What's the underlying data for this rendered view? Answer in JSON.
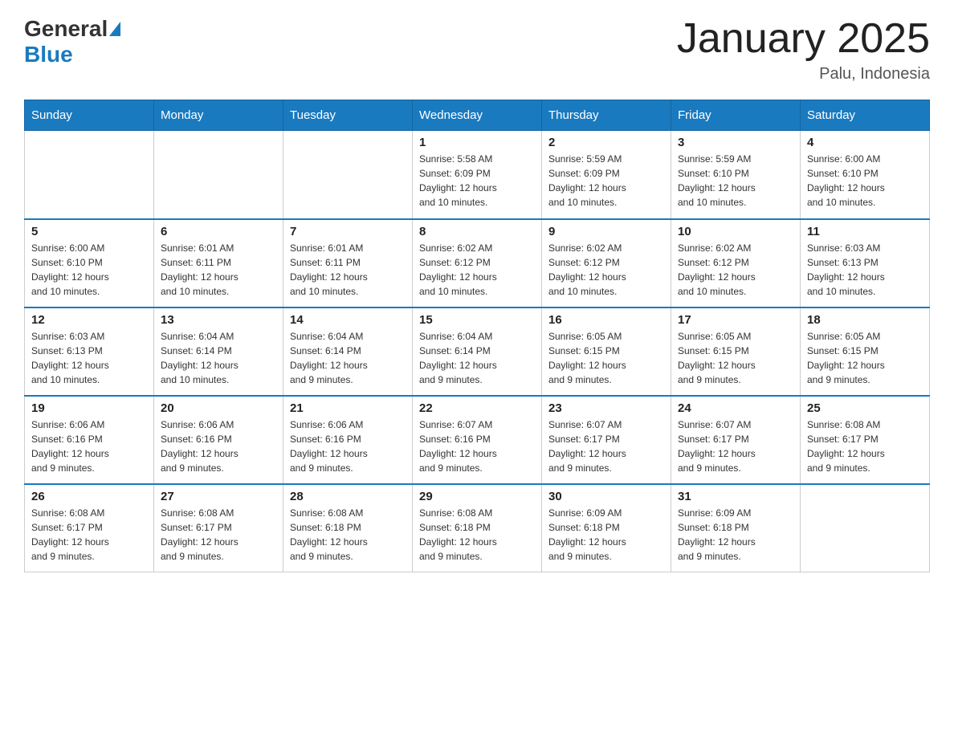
{
  "header": {
    "logo_general": "General",
    "logo_blue": "Blue",
    "title": "January 2025",
    "subtitle": "Palu, Indonesia"
  },
  "days_of_week": [
    "Sunday",
    "Monday",
    "Tuesday",
    "Wednesday",
    "Thursday",
    "Friday",
    "Saturday"
  ],
  "weeks": [
    [
      {
        "num": "",
        "info": ""
      },
      {
        "num": "",
        "info": ""
      },
      {
        "num": "",
        "info": ""
      },
      {
        "num": "1",
        "info": "Sunrise: 5:58 AM\nSunset: 6:09 PM\nDaylight: 12 hours\nand 10 minutes."
      },
      {
        "num": "2",
        "info": "Sunrise: 5:59 AM\nSunset: 6:09 PM\nDaylight: 12 hours\nand 10 minutes."
      },
      {
        "num": "3",
        "info": "Sunrise: 5:59 AM\nSunset: 6:10 PM\nDaylight: 12 hours\nand 10 minutes."
      },
      {
        "num": "4",
        "info": "Sunrise: 6:00 AM\nSunset: 6:10 PM\nDaylight: 12 hours\nand 10 minutes."
      }
    ],
    [
      {
        "num": "5",
        "info": "Sunrise: 6:00 AM\nSunset: 6:10 PM\nDaylight: 12 hours\nand 10 minutes."
      },
      {
        "num": "6",
        "info": "Sunrise: 6:01 AM\nSunset: 6:11 PM\nDaylight: 12 hours\nand 10 minutes."
      },
      {
        "num": "7",
        "info": "Sunrise: 6:01 AM\nSunset: 6:11 PM\nDaylight: 12 hours\nand 10 minutes."
      },
      {
        "num": "8",
        "info": "Sunrise: 6:02 AM\nSunset: 6:12 PM\nDaylight: 12 hours\nand 10 minutes."
      },
      {
        "num": "9",
        "info": "Sunrise: 6:02 AM\nSunset: 6:12 PM\nDaylight: 12 hours\nand 10 minutes."
      },
      {
        "num": "10",
        "info": "Sunrise: 6:02 AM\nSunset: 6:12 PM\nDaylight: 12 hours\nand 10 minutes."
      },
      {
        "num": "11",
        "info": "Sunrise: 6:03 AM\nSunset: 6:13 PM\nDaylight: 12 hours\nand 10 minutes."
      }
    ],
    [
      {
        "num": "12",
        "info": "Sunrise: 6:03 AM\nSunset: 6:13 PM\nDaylight: 12 hours\nand 10 minutes."
      },
      {
        "num": "13",
        "info": "Sunrise: 6:04 AM\nSunset: 6:14 PM\nDaylight: 12 hours\nand 10 minutes."
      },
      {
        "num": "14",
        "info": "Sunrise: 6:04 AM\nSunset: 6:14 PM\nDaylight: 12 hours\nand 9 minutes."
      },
      {
        "num": "15",
        "info": "Sunrise: 6:04 AM\nSunset: 6:14 PM\nDaylight: 12 hours\nand 9 minutes."
      },
      {
        "num": "16",
        "info": "Sunrise: 6:05 AM\nSunset: 6:15 PM\nDaylight: 12 hours\nand 9 minutes."
      },
      {
        "num": "17",
        "info": "Sunrise: 6:05 AM\nSunset: 6:15 PM\nDaylight: 12 hours\nand 9 minutes."
      },
      {
        "num": "18",
        "info": "Sunrise: 6:05 AM\nSunset: 6:15 PM\nDaylight: 12 hours\nand 9 minutes."
      }
    ],
    [
      {
        "num": "19",
        "info": "Sunrise: 6:06 AM\nSunset: 6:16 PM\nDaylight: 12 hours\nand 9 minutes."
      },
      {
        "num": "20",
        "info": "Sunrise: 6:06 AM\nSunset: 6:16 PM\nDaylight: 12 hours\nand 9 minutes."
      },
      {
        "num": "21",
        "info": "Sunrise: 6:06 AM\nSunset: 6:16 PM\nDaylight: 12 hours\nand 9 minutes."
      },
      {
        "num": "22",
        "info": "Sunrise: 6:07 AM\nSunset: 6:16 PM\nDaylight: 12 hours\nand 9 minutes."
      },
      {
        "num": "23",
        "info": "Sunrise: 6:07 AM\nSunset: 6:17 PM\nDaylight: 12 hours\nand 9 minutes."
      },
      {
        "num": "24",
        "info": "Sunrise: 6:07 AM\nSunset: 6:17 PM\nDaylight: 12 hours\nand 9 minutes."
      },
      {
        "num": "25",
        "info": "Sunrise: 6:08 AM\nSunset: 6:17 PM\nDaylight: 12 hours\nand 9 minutes."
      }
    ],
    [
      {
        "num": "26",
        "info": "Sunrise: 6:08 AM\nSunset: 6:17 PM\nDaylight: 12 hours\nand 9 minutes."
      },
      {
        "num": "27",
        "info": "Sunrise: 6:08 AM\nSunset: 6:17 PM\nDaylight: 12 hours\nand 9 minutes."
      },
      {
        "num": "28",
        "info": "Sunrise: 6:08 AM\nSunset: 6:18 PM\nDaylight: 12 hours\nand 9 minutes."
      },
      {
        "num": "29",
        "info": "Sunrise: 6:08 AM\nSunset: 6:18 PM\nDaylight: 12 hours\nand 9 minutes."
      },
      {
        "num": "30",
        "info": "Sunrise: 6:09 AM\nSunset: 6:18 PM\nDaylight: 12 hours\nand 9 minutes."
      },
      {
        "num": "31",
        "info": "Sunrise: 6:09 AM\nSunset: 6:18 PM\nDaylight: 12 hours\nand 9 minutes."
      },
      {
        "num": "",
        "info": ""
      }
    ]
  ]
}
